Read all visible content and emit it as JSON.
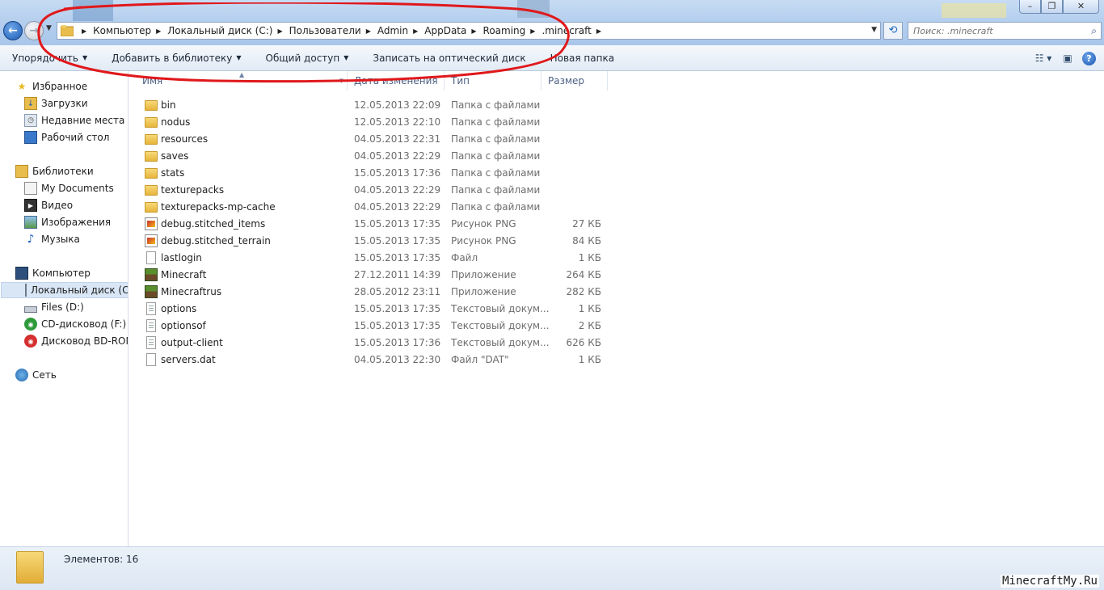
{
  "window": {
    "min_glyph": "–",
    "max_glyph": "❐",
    "close_glyph": "✕"
  },
  "nav": {
    "back_glyph": "←",
    "forward_glyph": "→",
    "history_glyph": "▼"
  },
  "address": {
    "breadcrumbs": [
      "Компьютер",
      "Локальный диск (C:)",
      "Пользователи",
      "Admin",
      "AppData",
      "Roaming",
      ".minecraft"
    ],
    "dropdown_glyph": "▼",
    "refresh_glyph": "⟲"
  },
  "search": {
    "placeholder": "Поиск: .minecraft"
  },
  "toolbar": {
    "organize": "Упорядочить",
    "add_to_library": "Добавить в библиотеку",
    "share": "Общий доступ",
    "burn": "Записать на оптический диск",
    "new_folder": "Новая папка",
    "caret": "▼"
  },
  "sidebar": {
    "favorites": "Избранное",
    "downloads": "Загрузки",
    "recent": "Недавние места",
    "desktop": "Рабочий стол",
    "libraries": "Библиотеки",
    "my_documents": "My Documents",
    "video": "Видео",
    "images": "Изображения",
    "music": "Музыка",
    "computer": "Компьютер",
    "local_disk": "Локальный диск (C",
    "files_d": "Files (D:)",
    "cd_drive": "CD-дисковод (F:) M",
    "bd_drive": "Дисковод BD-ROM",
    "network": "Сеть"
  },
  "columns": {
    "name": "Имя",
    "date": "Дата изменения",
    "type": "Тип",
    "size": "Размер"
  },
  "files": [
    {
      "name": "bin",
      "date": "12.05.2013 22:09",
      "type": "Папка с файлами",
      "size": "",
      "icon": "folder"
    },
    {
      "name": "nodus",
      "date": "12.05.2013 22:10",
      "type": "Папка с файлами",
      "size": "",
      "icon": "folder"
    },
    {
      "name": "resources",
      "date": "04.05.2013 22:31",
      "type": "Папка с файлами",
      "size": "",
      "icon": "folder"
    },
    {
      "name": "saves",
      "date": "04.05.2013 22:29",
      "type": "Папка с файлами",
      "size": "",
      "icon": "folder"
    },
    {
      "name": "stats",
      "date": "15.05.2013 17:36",
      "type": "Папка с файлами",
      "size": "",
      "icon": "folder"
    },
    {
      "name": "texturepacks",
      "date": "04.05.2013 22:29",
      "type": "Папка с файлами",
      "size": "",
      "icon": "folder"
    },
    {
      "name": "texturepacks-mp-cache",
      "date": "04.05.2013 22:29",
      "type": "Папка с файлами",
      "size": "",
      "icon": "folder"
    },
    {
      "name": "debug.stitched_items",
      "date": "15.05.2013 17:35",
      "type": "Рисунок PNG",
      "size": "27 КБ",
      "icon": "png"
    },
    {
      "name": "debug.stitched_terrain",
      "date": "15.05.2013 17:35",
      "type": "Рисунок PNG",
      "size": "84 КБ",
      "icon": "png"
    },
    {
      "name": "lastlogin",
      "date": "15.05.2013 17:35",
      "type": "Файл",
      "size": "1 КБ",
      "icon": "file"
    },
    {
      "name": "Minecraft",
      "date": "27.12.2011 14:39",
      "type": "Приложение",
      "size": "264 КБ",
      "icon": "app"
    },
    {
      "name": "Minecraftrus",
      "date": "28.05.2012 23:11",
      "type": "Приложение",
      "size": "282 КБ",
      "icon": "app"
    },
    {
      "name": "options",
      "date": "15.05.2013 17:35",
      "type": "Текстовый докум...",
      "size": "1 КБ",
      "icon": "text"
    },
    {
      "name": "optionsof",
      "date": "15.05.2013 17:35",
      "type": "Текстовый докум...",
      "size": "2 КБ",
      "icon": "text"
    },
    {
      "name": "output-client",
      "date": "15.05.2013 17:36",
      "type": "Текстовый докум...",
      "size": "626 КБ",
      "icon": "text"
    },
    {
      "name": "servers.dat",
      "date": "04.05.2013 22:30",
      "type": "Файл \"DAT\"",
      "size": "1 КБ",
      "icon": "file"
    }
  ],
  "status": {
    "item_count": "Элементов: 16"
  },
  "watermark": "MinecraftMy.Ru",
  "colors": {
    "annotation": "#e0181b",
    "accent": "#1d5db7"
  }
}
